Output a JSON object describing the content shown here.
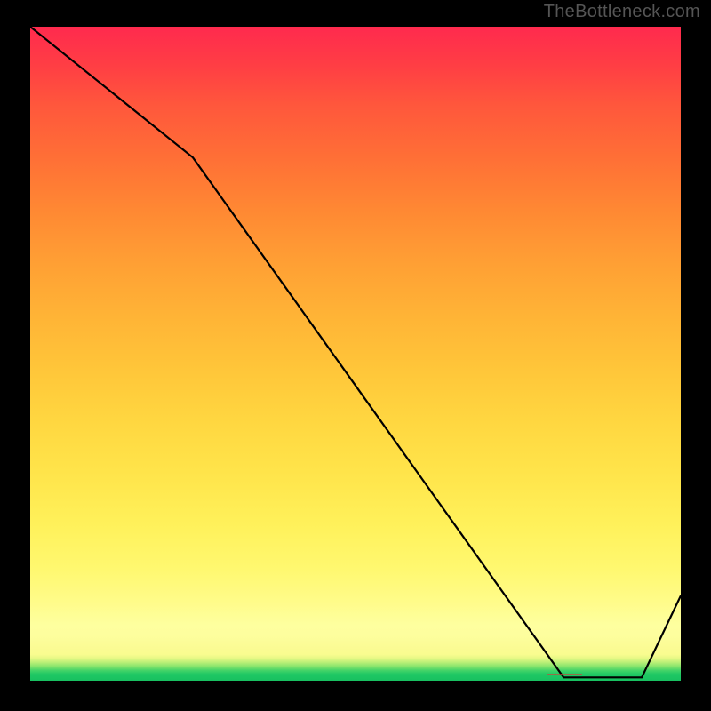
{
  "watermark": "TheBottleneck.com",
  "chart_data": {
    "type": "line",
    "title": "",
    "xlabel": "",
    "ylabel": "",
    "x": [
      0,
      25,
      82,
      94,
      100
    ],
    "values": [
      100,
      80,
      0.5,
      0.5,
      13
    ],
    "xlim": [
      0,
      100
    ],
    "ylim": [
      0,
      100
    ],
    "optimal_range_x": [
      78,
      86
    ],
    "annotations": [
      {
        "text": "····················",
        "x_percent": 82
      }
    ],
    "background_gradient": {
      "top": "#ff2a4e",
      "middle": "#ffe44a",
      "bottom": "#18c060",
      "description": "vertical heat gradient red→yellow→green indicating bottleneck severity; green band at bottom marks optimal"
    }
  }
}
